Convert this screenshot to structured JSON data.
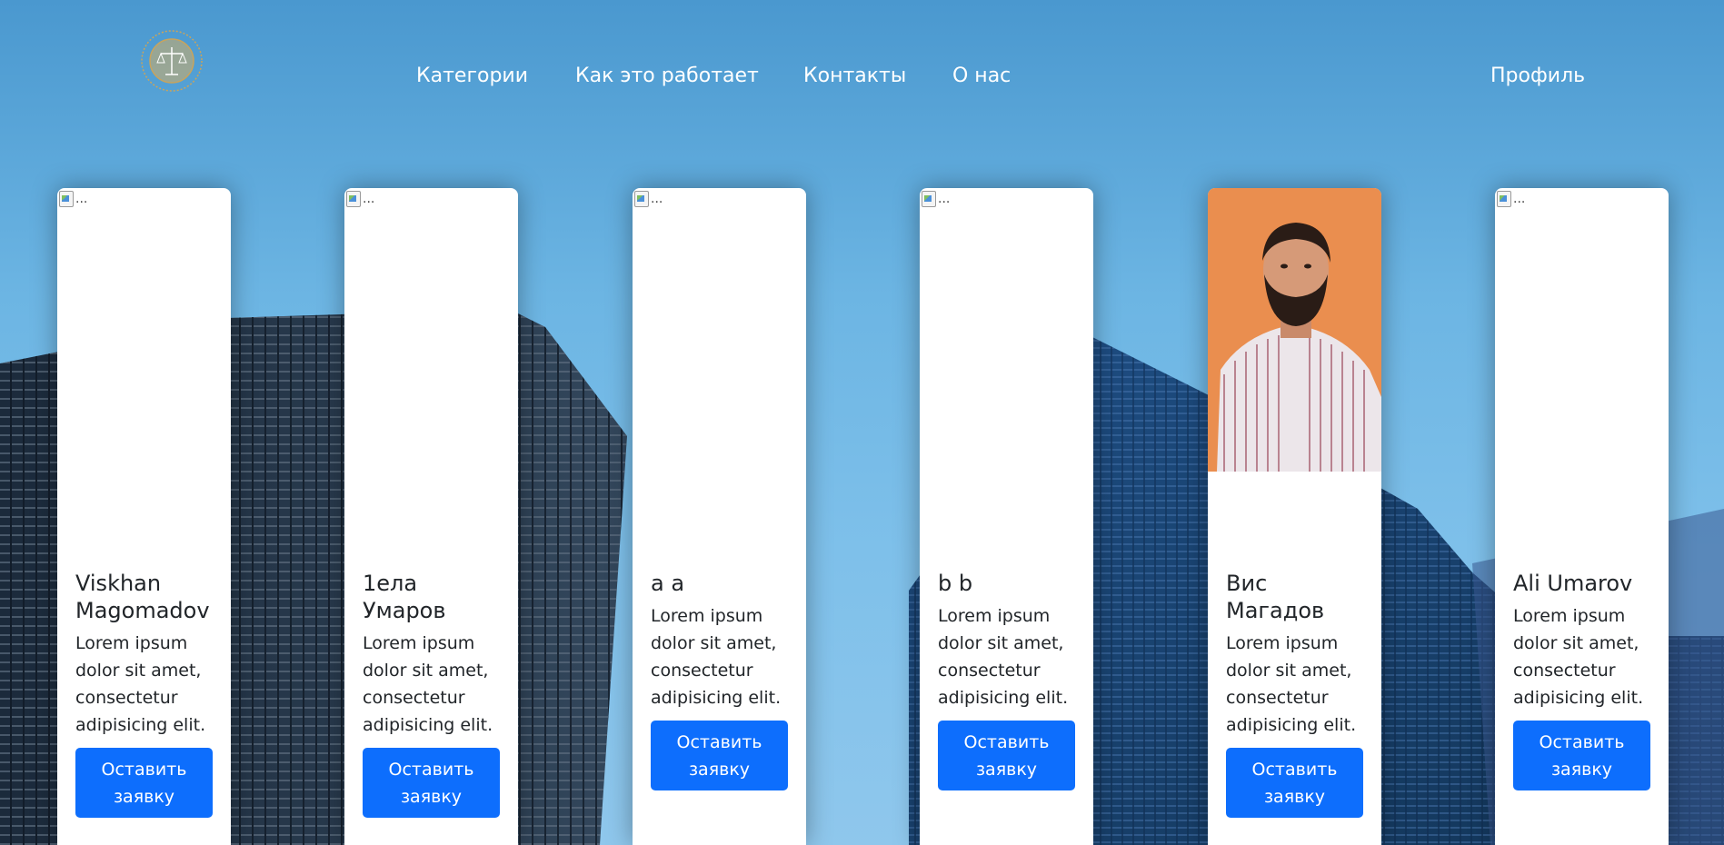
{
  "nav": {
    "links": [
      "Категории",
      "Как это работает",
      "Контакты",
      "О нас"
    ],
    "profile": "Профиль"
  },
  "cards": [
    {
      "name": "Viskhan Magomadov",
      "text": "Lorem ipsum dolor sit amet, consectetur adipisicing elit.",
      "button": "Оставить заявку",
      "image_alt": "...",
      "photo": false
    },
    {
      "name": "1ела Умаров",
      "text": "Lorem ipsum dolor sit amet, consectetur adipisicing elit.",
      "button": "Оставить заявку",
      "image_alt": "...",
      "photo": false
    },
    {
      "name": "a a",
      "text": "Lorem ipsum dolor sit amet, consectetur adipisicing elit.",
      "button": "Оставить заявку",
      "image_alt": "...",
      "photo": false
    },
    {
      "name": "b b",
      "text": "Lorem ipsum dolor sit amet, consectetur adipisicing elit.",
      "button": "Оставить заявку",
      "image_alt": "...",
      "photo": false
    },
    {
      "name": "Вис Магадов",
      "text": "Lorem ipsum dolor sit amet, consectetur adipisicing elit.",
      "button": "Оставить заявку",
      "image_alt": "",
      "photo": true
    },
    {
      "name": "Ali Umarov",
      "text": "Lorem ipsum dolor sit amet, consectetur adipisicing elit.",
      "button": "Оставить заявку",
      "image_alt": "...",
      "photo": false
    }
  ],
  "colors": {
    "accent": "#0d6efd",
    "nav_text": "#ffffff",
    "logo_gold": "#c9a45c",
    "photo_background": "#e9894a"
  }
}
